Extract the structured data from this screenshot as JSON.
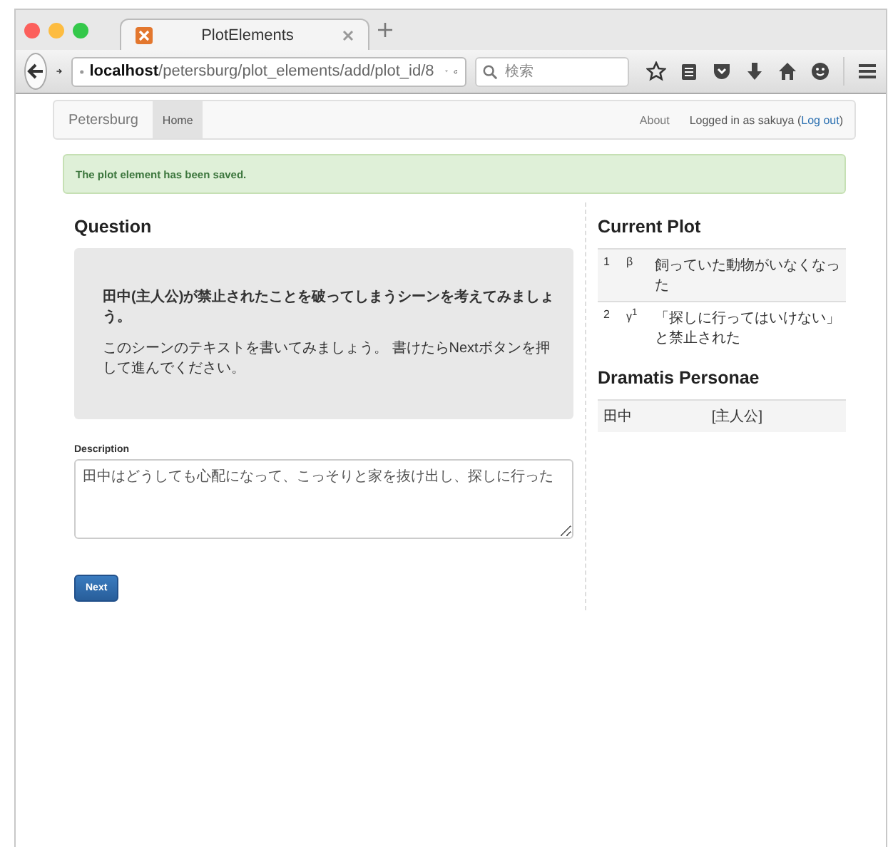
{
  "browser": {
    "tab_title": "PlotElements",
    "url_host": "localhost",
    "url_path": "/petersburg/plot_elements/add/plot_id/8",
    "search": {
      "placeholder": "検索"
    }
  },
  "navbar": {
    "brand": "Petersburg",
    "items": [
      {
        "label": "Home",
        "selected": true
      }
    ],
    "about": "About",
    "login_text": "Logged in as sakuya",
    "logout_open": "(",
    "logout": "Log out",
    "logout_close": ")"
  },
  "alert": "The plot element has been saved.",
  "question": {
    "heading": "Question",
    "prompt": "田中(主人公)が禁止されたことを破ってしまうシーンを考えてみましょう。",
    "instruction": "このシーンのテキストを書いてみましょう。 書けたらNextボタンを押して進んでください。"
  },
  "description": {
    "label": "Description",
    "value": "田中はどうしても心配になって、こっそりと家を抜け出し、探しに行った"
  },
  "next_button": "Next",
  "current_plot": {
    "heading": "Current Plot",
    "rows": [
      {
        "number": "1",
        "symbol": "β",
        "text": "飼っていた動物がいなくなった"
      },
      {
        "number": "2",
        "symbol": "γ$^{1}$",
        "text": "「探しに行ってはいけない」と禁止された"
      }
    ]
  },
  "dramatis_personae": {
    "heading": "Dramatis Personae",
    "rows": [
      {
        "name": "田中",
        "role": "[主人公]"
      }
    ]
  }
}
